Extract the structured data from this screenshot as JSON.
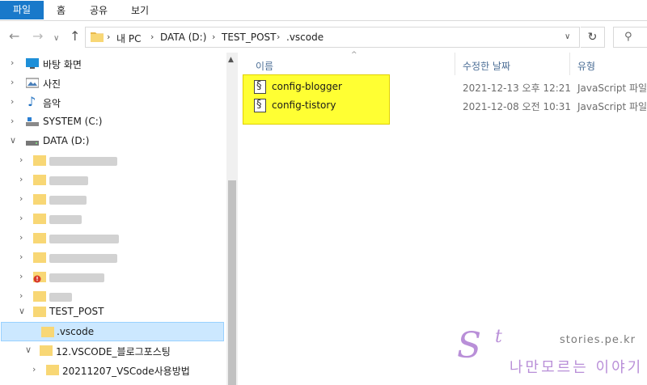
{
  "ribbon": {
    "tabs": [
      "파일",
      "홈",
      "공유",
      "보기"
    ]
  },
  "address": {
    "crumbs": [
      "내 PC",
      "DATA (D:)",
      "TEST_POST",
      ".vscode"
    ],
    "back_icon": "arrow-left-icon",
    "forward_icon": "arrow-right-icon",
    "up_icon": "arrow-up-icon",
    "refresh_icon": "refresh-icon",
    "search_icon": "search-icon"
  },
  "nav": {
    "desktop": "바탕 화면",
    "pictures": "사진",
    "music": "음악",
    "system_c": "SYSTEM (C:)",
    "data_d": "DATA (D:)",
    "test_post": "TEST_POST",
    "vscode": ".vscode",
    "vscode_blog": "12.VSCODE_블로그포스팅",
    "vscode_usage": "20211207_VSCode사용방법"
  },
  "columns": {
    "name": "이름",
    "date": "수정한 날짜",
    "type": "유형"
  },
  "files": [
    {
      "name": "config-blogger",
      "date": "2021-12-13 오후 12:21",
      "type": "JavaScript 파일"
    },
    {
      "name": "config-tistory",
      "date": "2021-12-08 오전 10:31",
      "type": "JavaScript 파일"
    }
  ],
  "watermark": {
    "url": "stories.pe.kr",
    "logo_s": "S",
    "logo_t": "t",
    "tagline": "나만모르는 이야기"
  },
  "colors": {
    "ribbon_file_tab": "#1979ca",
    "selection": "#cce8ff",
    "highlight": "#ffff33",
    "folder": "#f8d775",
    "watermark": "#b98fd8"
  }
}
